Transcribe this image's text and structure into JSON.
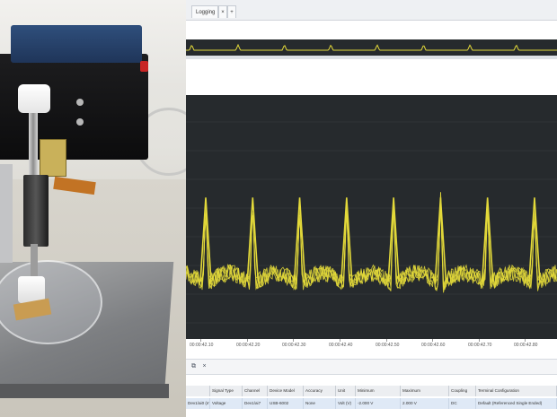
{
  "tabs": {
    "active_label": "Logging",
    "close_glyph": "×",
    "add_glyph": "+"
  },
  "time_axis": {
    "labels": [
      "00:00:42.10",
      "00:00:42.20",
      "00:00:42.30",
      "00:00:42.40",
      "00:00:42.50",
      "00:00:42.60",
      "00:00:42.70",
      "00:00:42.80"
    ]
  },
  "toolstrip": {
    "icons": [
      "copy-icon",
      "close-icon"
    ],
    "glyphs": [
      "⧉",
      "×"
    ]
  },
  "channel_table": {
    "headers": [
      "",
      "Signal Type",
      "Channel",
      "Device Model",
      "Accuracy",
      "Unit",
      "Minimum",
      "Maximum",
      "Coupling",
      "Terminal Configuration"
    ],
    "row": [
      "Dev1/ai0 (mV)",
      "Voltage",
      "Dev1/ai7",
      "USB-6002",
      "None",
      "Volt (V)",
      "-2.000 V",
      "2.000 V",
      "DC",
      "Default (Referenced Single Ended)"
    ]
  },
  "chart_data": {
    "type": "line",
    "title": "",
    "xlabel": "",
    "ylabel": "",
    "series_color": "#e3d93a",
    "background": "#262a2d",
    "grid": true,
    "peak_count": 8,
    "baseline_level": 0.22,
    "peak_level": 0.58,
    "overview_peak_count": 8
  }
}
